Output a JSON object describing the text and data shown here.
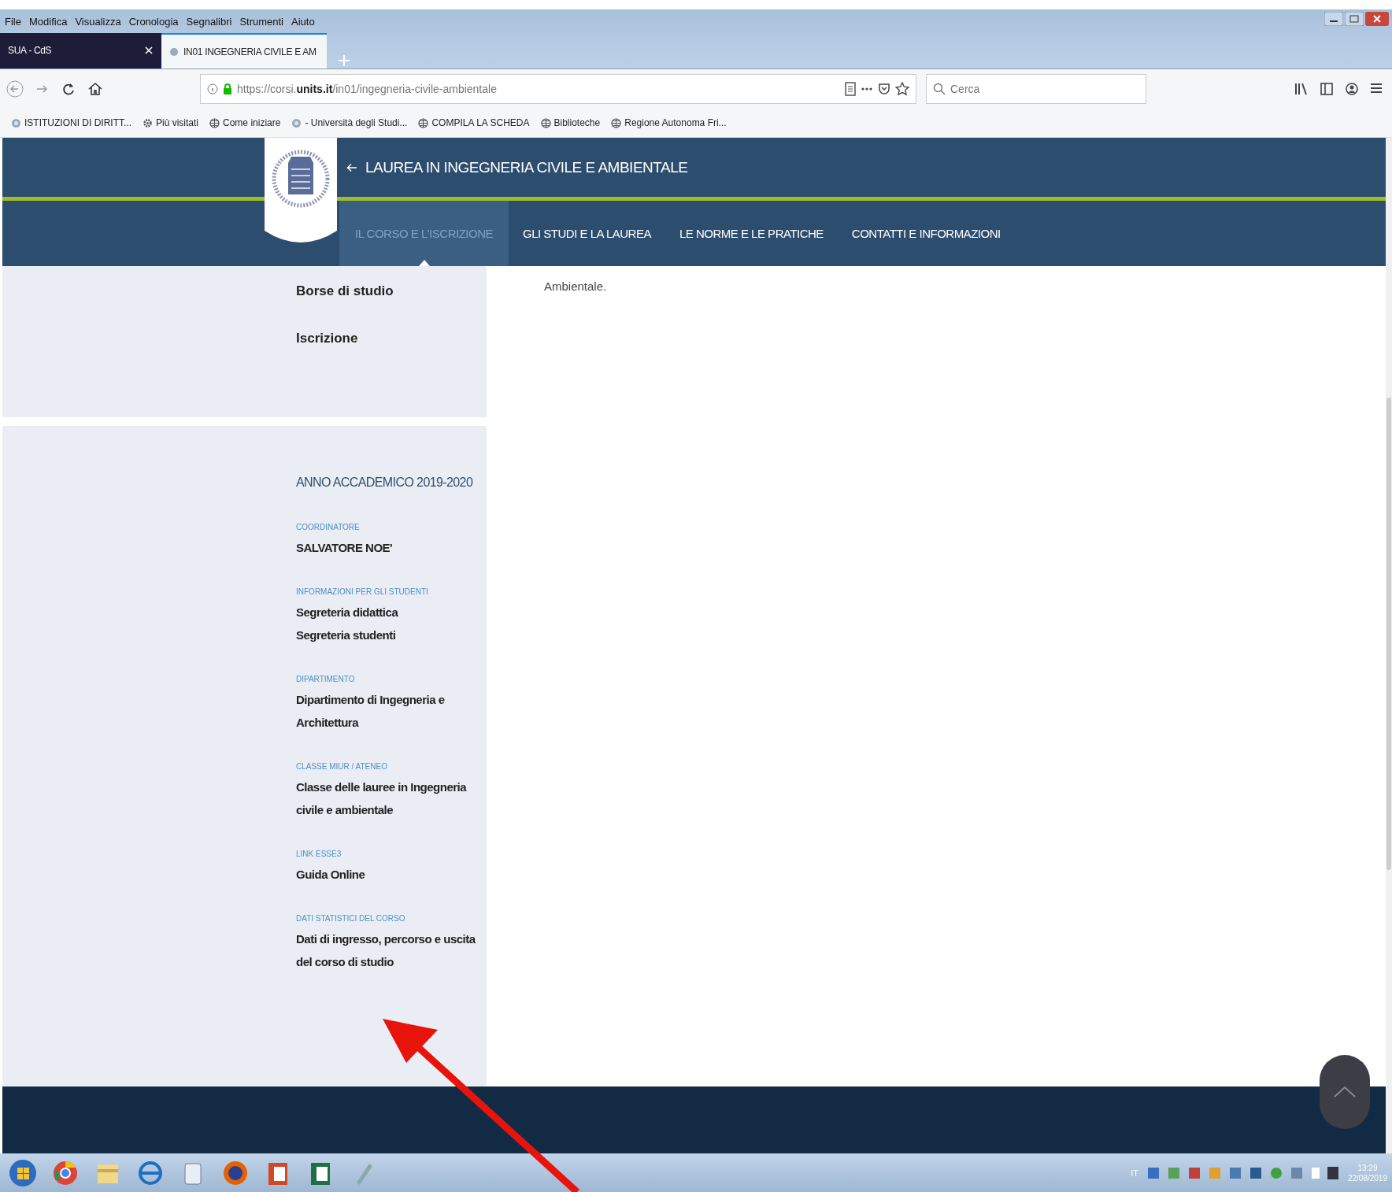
{
  "menu": [
    "File",
    "Modifica",
    "Visualizza",
    "Cronologia",
    "Segnalibri",
    "Strumenti",
    "Aiuto"
  ],
  "tabs": [
    {
      "label": "SUA - CdS",
      "selected": false
    },
    {
      "label": "IN01 INGEGNERIA CIVILE E AM",
      "selected": true
    }
  ],
  "address": {
    "value": "https://corsi.**units.it**/in01/ingegneria-civile-ambientale"
  },
  "search": {
    "placeholder": "Cerca"
  },
  "bookmarks": [
    {
      "label": "ISTITUZIONI DI DIRITT...",
      "kind": "site"
    },
    {
      "label": "Più visitati",
      "kind": "gear"
    },
    {
      "label": "Come iniziare",
      "kind": "globe"
    },
    {
      "label": "- Università degli Studi...",
      "kind": "site"
    },
    {
      "label": "COMPILA LA SCHEDA",
      "kind": "globe"
    },
    {
      "label": "Biblioteche",
      "kind": "globe"
    },
    {
      "label": "Regione Autonoma Fri...",
      "kind": "globe"
    }
  ],
  "site": {
    "title": "LAUREA IN INGEGNERIA CIVILE E AMBIENTALE",
    "nav": [
      {
        "label": "IL CORSO E L'ISCRIZIONE",
        "selected": true
      },
      {
        "label": "GLI STUDI E LA LAUREA",
        "selected": false
      },
      {
        "label": "LE NORME E LE PRATICHE",
        "selected": false
      },
      {
        "label": "CONTATTI E INFORMAZIONI",
        "selected": false
      }
    ]
  },
  "sidebar_menu": [
    "Borse di studio",
    "Iscrizione"
  ],
  "info": {
    "heading": "ANNO ACCADEMICO 2019-2020",
    "sections": [
      {
        "label": "COORDINATORE",
        "lines": [
          "SALVATORE NOE'"
        ]
      },
      {
        "label": "INFORMAZIONI PER GLI STUDENTI",
        "lines": [
          "Segreteria didattica",
          "Segreteria studenti"
        ]
      },
      {
        "label": "DIPARTIMENTO",
        "lines": [
          "Dipartimento di Ingegneria e Architettura"
        ]
      },
      {
        "label": "CLASSE MIUR / ATENEO",
        "lines": [
          "Classe delle lauree in Ingegneria civile e ambientale"
        ]
      },
      {
        "label": "LINK ESSE3",
        "lines": [
          "Guida Online"
        ]
      },
      {
        "label": "DATI STATISTICI DEL CORSO",
        "lines": [
          "Dati di ingresso, percorso e uscita del corso di studio"
        ]
      }
    ]
  },
  "content": {
    "text": "Ambientale."
  },
  "taskbar": {
    "language": "IT",
    "time": "13:29",
    "date": "22/08/2019"
  }
}
